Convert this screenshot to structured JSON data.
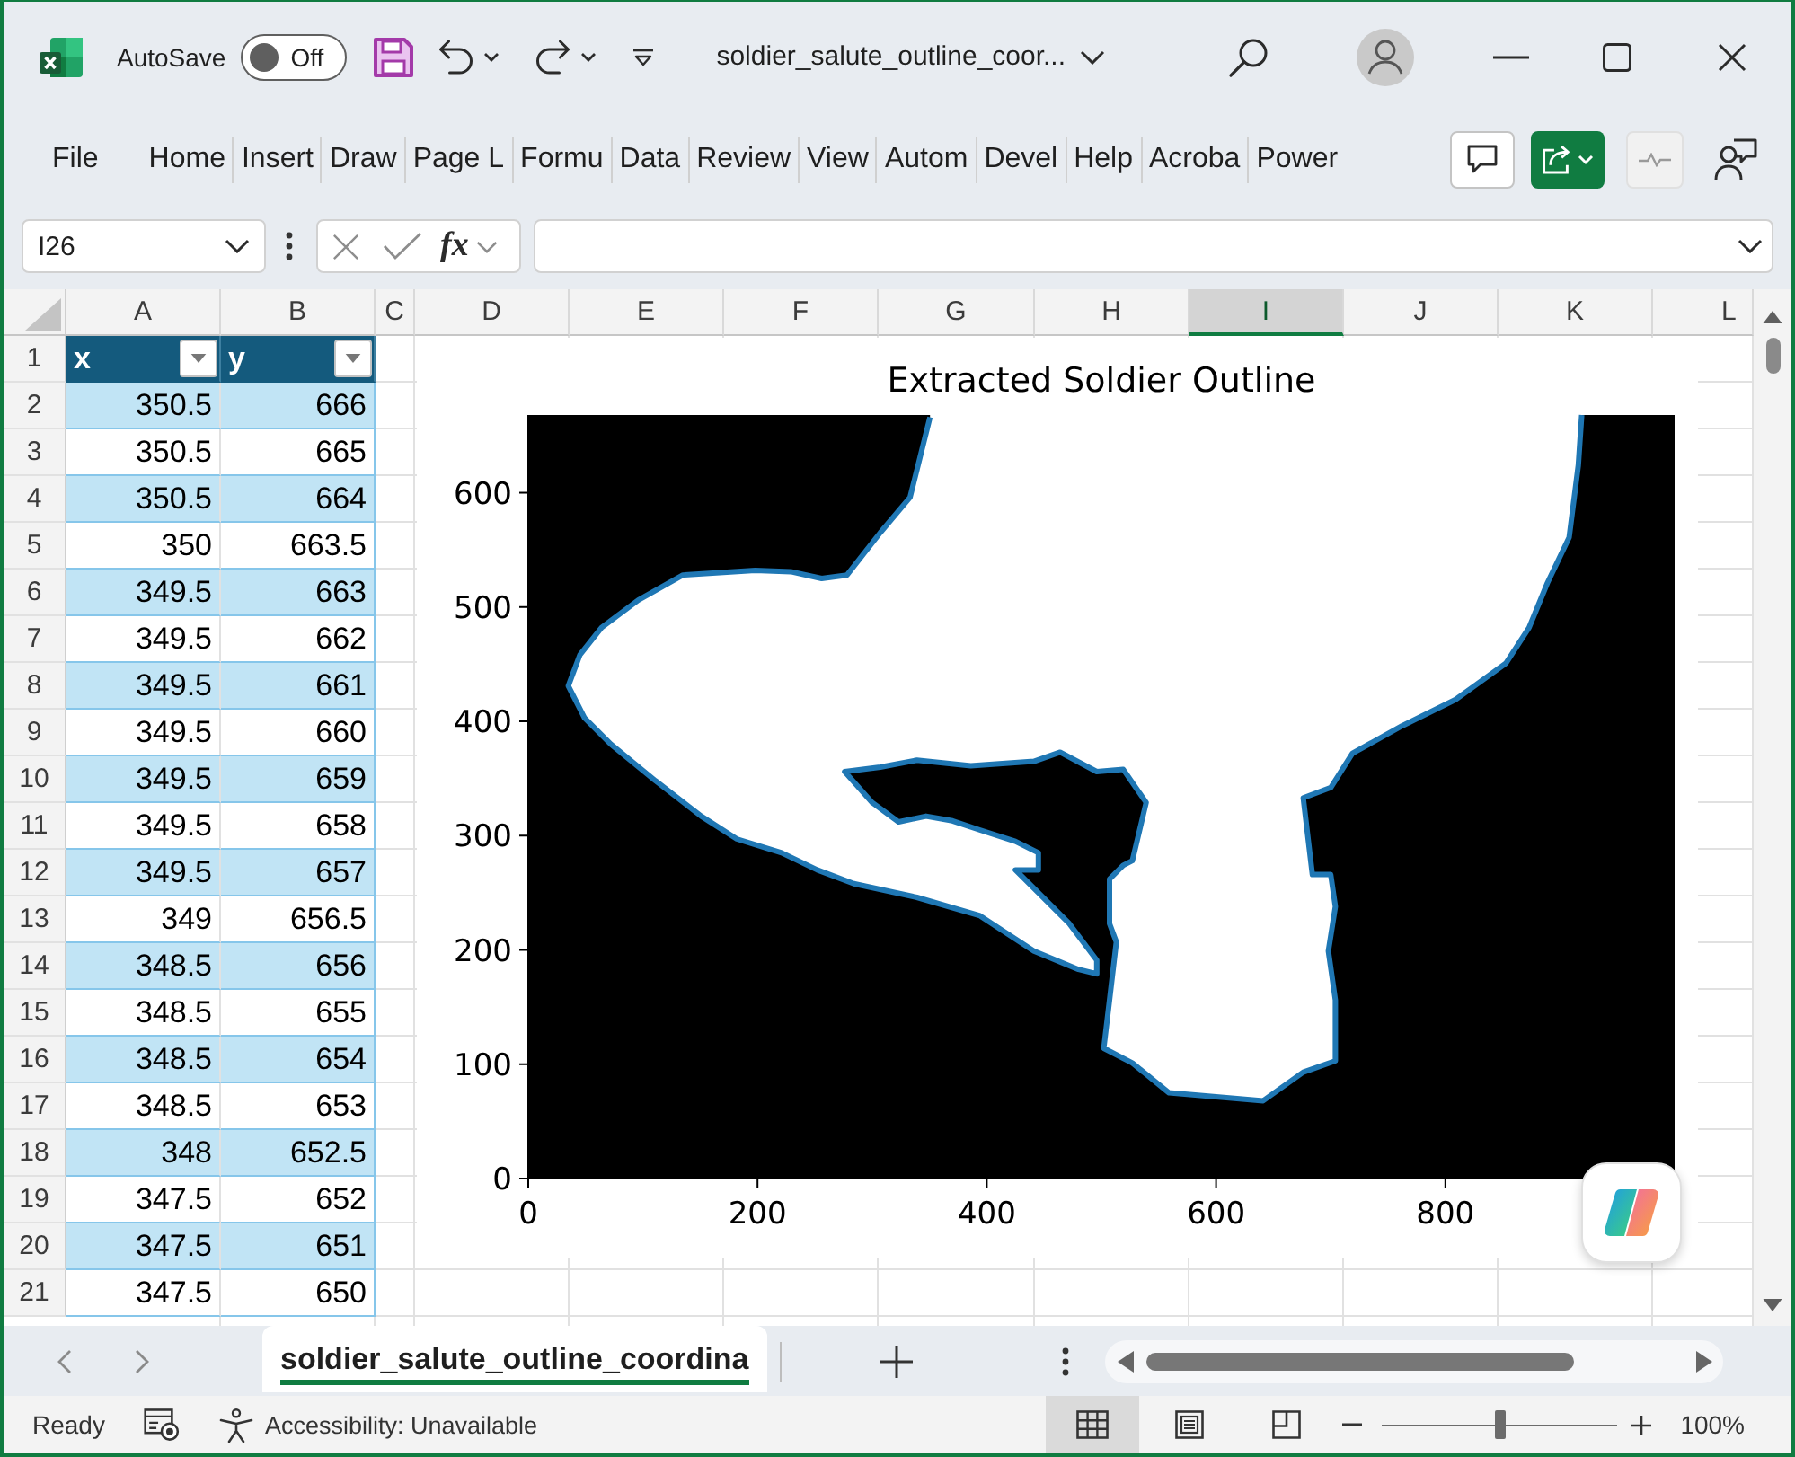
{
  "title_bar": {
    "autosave_label": "AutoSave",
    "autosave": {
      "label": "Off",
      "on": false
    },
    "document_title": "soldier_salute_outline_coor..."
  },
  "ribbon": {
    "tabs": [
      {
        "label": "File",
        "selected": false
      },
      {
        "label": "Home",
        "selected": false
      },
      {
        "label": "Insert",
        "selected": false
      },
      {
        "label": "Draw",
        "selected": false
      },
      {
        "label": "Page L",
        "selected": false
      },
      {
        "label": "Formu",
        "selected": false
      },
      {
        "label": "Data",
        "selected": false
      },
      {
        "label": "Review",
        "selected": false
      },
      {
        "label": "View",
        "selected": false
      },
      {
        "label": "Autom",
        "selected": false
      },
      {
        "label": "Devel",
        "selected": false
      },
      {
        "label": "Help",
        "selected": false
      },
      {
        "label": "Acroba",
        "selected": false
      },
      {
        "label": "Power",
        "selected": false
      }
    ]
  },
  "formula_bar": {
    "name_box": "I26",
    "function_button": "fx"
  },
  "sheet": {
    "columns": [
      {
        "label": "A",
        "selected": false
      },
      {
        "label": "B",
        "selected": false
      },
      {
        "label": "C",
        "selected": false
      },
      {
        "label": "D",
        "selected": false
      },
      {
        "label": "E",
        "selected": false
      },
      {
        "label": "F",
        "selected": false
      },
      {
        "label": "G",
        "selected": false
      },
      {
        "label": "H",
        "selected": false
      },
      {
        "label": "I",
        "selected": true
      },
      {
        "label": "J",
        "selected": false
      },
      {
        "label": "K",
        "selected": false
      },
      {
        "label": "L",
        "selected": false
      }
    ],
    "row_numbers": [
      "1",
      "2",
      "3",
      "4",
      "5",
      "6",
      "7",
      "8",
      "9",
      "10",
      "11",
      "12",
      "13",
      "14",
      "15",
      "16",
      "17",
      "18",
      "19",
      "20",
      "21"
    ],
    "table": {
      "headers": [
        "x",
        "y"
      ],
      "rows": [
        [
          "350.5",
          "666"
        ],
        [
          "350.5",
          "665"
        ],
        [
          "350.5",
          "664"
        ],
        [
          "350",
          "663.5"
        ],
        [
          "349.5",
          "663"
        ],
        [
          "349.5",
          "662"
        ],
        [
          "349.5",
          "661"
        ],
        [
          "349.5",
          "660"
        ],
        [
          "349.5",
          "659"
        ],
        [
          "349.5",
          "658"
        ],
        [
          "349.5",
          "657"
        ],
        [
          "349",
          "656.5"
        ],
        [
          "348.5",
          "656"
        ],
        [
          "348.5",
          "655"
        ],
        [
          "348.5",
          "654"
        ],
        [
          "348.5",
          "653"
        ],
        [
          "348",
          "652.5"
        ],
        [
          "347.5",
          "652"
        ],
        [
          "347.5",
          "651"
        ],
        [
          "347.5",
          "650"
        ]
      ]
    },
    "chart": {
      "chart_data": {
        "type": "line",
        "title": "Extracted Soldier Outline",
        "x": [
          350.5,
          333,
          307,
          278,
          256,
          229,
          198,
          135,
          96,
          64,
          45,
          35,
          49,
          72,
          111,
          151,
          182,
          221,
          252,
          284,
          339,
          394,
          441,
          480,
          496,
          496,
          472,
          441,
          425,
          445,
          445,
          425,
          394,
          370,
          347,
          323,
          300,
          276,
          307,
          339,
          386,
          441,
          464,
          496,
          519,
          539,
          527,
          519,
          507,
          507,
          513,
          507,
          502,
          527,
          559,
          641,
          676,
          704,
          704,
          698,
          704,
          700,
          684,
          676,
          700,
          719,
          762,
          809,
          853,
          873,
          889,
          908,
          916,
          919
        ],
        "series": [
          {
            "color": "#1f77b4",
            "values": [
              666,
              596,
              565,
              528,
              525,
              531,
              532,
              528,
              506,
              482,
              458,
              431,
              403,
              380,
              348,
              317,
              297,
              285,
              270,
              258,
              246,
              230,
              199,
              183,
              179,
              191,
              223,
              254,
              270,
              270,
              285,
              295,
              305,
              313,
              317,
              312,
              329,
              356,
              360,
              366,
              361,
              365,
              373,
              356,
              358,
              329,
              278,
              274,
              262,
              223,
              207,
              156,
              114,
              101,
              75,
              68,
              93,
              103,
              156,
              199,
              238,
              266,
              266,
              333,
              342,
              372,
              396,
              419,
              451,
              482,
              521,
              561,
              624,
              668
            ]
          }
        ],
        "xlim": [
          0,
          1000
        ],
        "ylim": [
          0,
          668
        ],
        "xticks": [
          0,
          200,
          400,
          600,
          800
        ],
        "yticks": [
          0,
          100,
          200,
          300,
          400,
          500,
          600
        ]
      }
    }
  },
  "sheet_tabs": [
    {
      "label": "soldier_salute_outline_coordina",
      "selected": true
    }
  ],
  "status_bar": {
    "status": "Ready",
    "accessibility": "Accessibility: Unavailable",
    "views": [
      {
        "kind": "normal",
        "selected": true
      },
      {
        "kind": "page_layout",
        "selected": false
      },
      {
        "kind": "page_break",
        "selected": false
      }
    ],
    "zoom": {
      "level": 0.5,
      "reading": "100%"
    }
  }
}
